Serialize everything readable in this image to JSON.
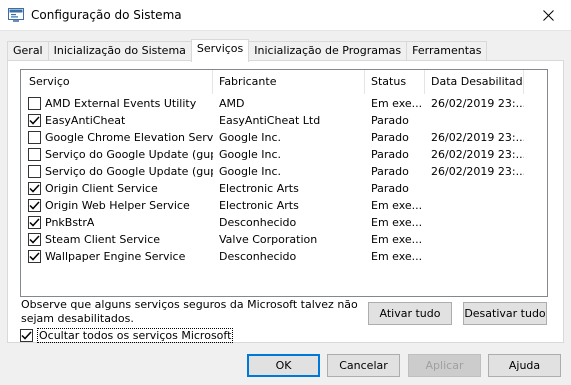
{
  "window": {
    "title": "Configuração do Sistema"
  },
  "tabs": [
    "Geral",
    "Inicialização do Sistema",
    "Serviços",
    "Inicialização de Programas",
    "Ferramentas"
  ],
  "columns": [
    "Serviço",
    "Fabricante",
    "Status",
    "Data Desabilitada"
  ],
  "services": [
    {
      "name": "AMD External Events Utility",
      "maker": "AMD",
      "status": "Em exe...",
      "date": "26/02/2019 23:...",
      "checked": false
    },
    {
      "name": "EasyAntiCheat",
      "maker": "EasyAntiCheat Ltd",
      "status": "Parado",
      "date": "",
      "checked": true
    },
    {
      "name": "Google Chrome Elevation Service",
      "maker": "Google Inc.",
      "status": "Parado",
      "date": "26/02/2019 23:...",
      "checked": false
    },
    {
      "name": "Serviço do Google Update (gupd...",
      "maker": "Google Inc.",
      "status": "Parado",
      "date": "26/02/2019 23:...",
      "checked": false
    },
    {
      "name": "Serviço do Google Update (gupd...",
      "maker": "Google Inc.",
      "status": "Parado",
      "date": "26/02/2019 23:...",
      "checked": false
    },
    {
      "name": "Origin Client Service",
      "maker": "Electronic Arts",
      "status": "Parado",
      "date": "",
      "checked": true
    },
    {
      "name": "Origin Web Helper Service",
      "maker": "Electronic Arts",
      "status": "Em exe...",
      "date": "",
      "checked": true
    },
    {
      "name": "PnkBstrA",
      "maker": "Desconhecido",
      "status": "Em exe...",
      "date": "",
      "checked": true
    },
    {
      "name": "Steam Client Service",
      "maker": "Valve Corporation",
      "status": "Em exe...",
      "date": "",
      "checked": true
    },
    {
      "name": "Wallpaper Engine Service",
      "maker": "Desconhecido",
      "status": "Em exe...",
      "date": "",
      "checked": true
    }
  ],
  "notice": "Observe que alguns serviços seguros da Microsoft talvez não sejam desabilitados.",
  "buttons": {
    "enable_all": "Ativar tudo",
    "disable_all": "Desativar tudo",
    "ok": "OK",
    "cancel": "Cancelar",
    "apply": "Aplicar",
    "help": "Ajuda"
  },
  "hide_ms": {
    "label": "Ocultar todos os serviços Microsoft",
    "checked": true
  }
}
